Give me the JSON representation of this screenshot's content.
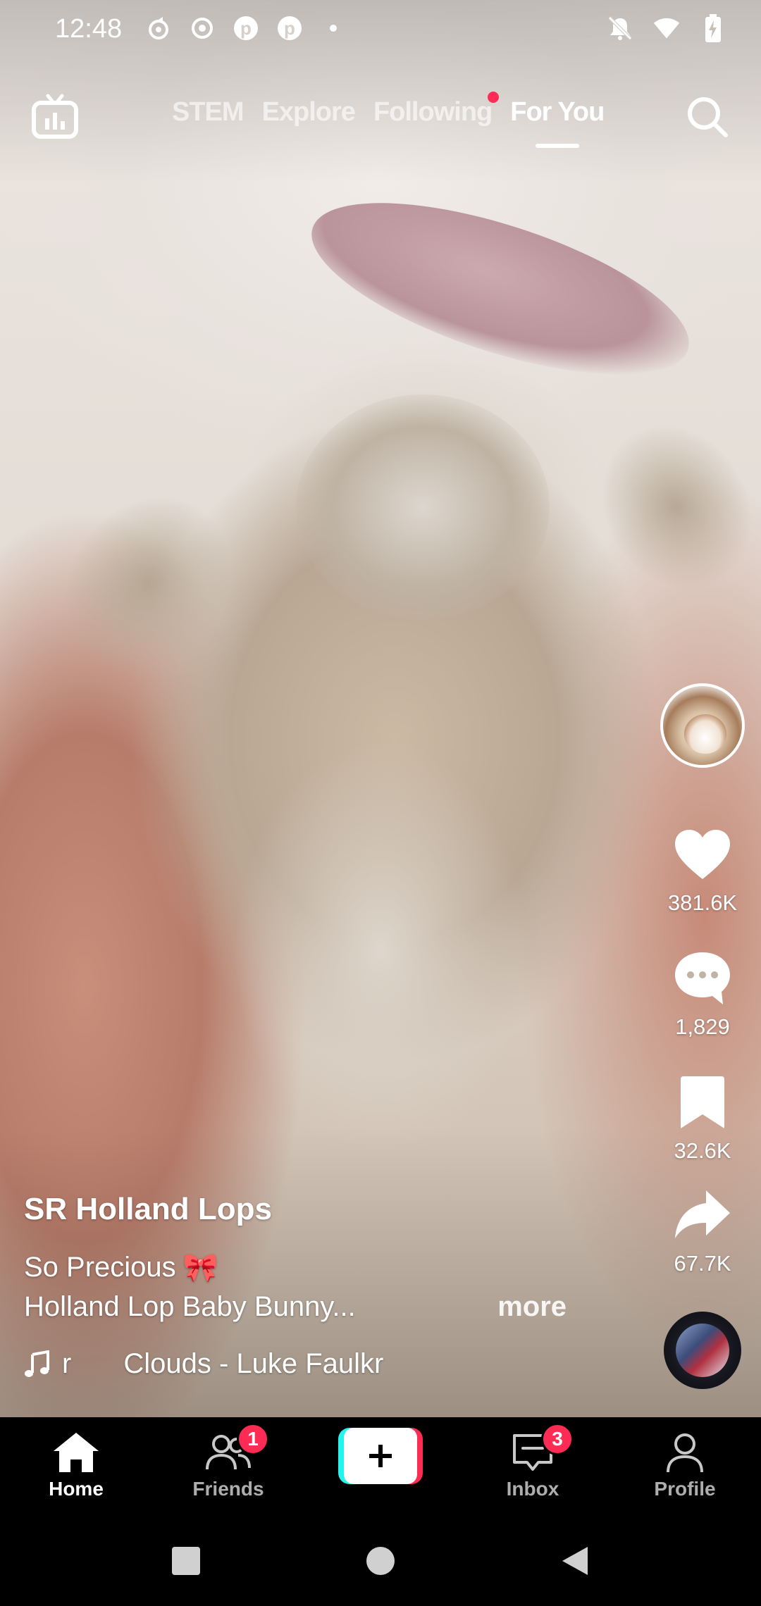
{
  "status_bar": {
    "time": "12:48",
    "left_icons": [
      "sync-icon",
      "record-icon",
      "pinterest-icon",
      "pinterest-icon",
      "dot-icon"
    ],
    "right_icons": [
      "mute-icon",
      "wifi-icon",
      "battery-charging-icon"
    ]
  },
  "top_nav": {
    "tabs": [
      {
        "label": "STEM",
        "active": false
      },
      {
        "label": "Explore",
        "active": false
      },
      {
        "label": "Following",
        "active": false,
        "dot": true
      },
      {
        "label": "For You",
        "active": true
      }
    ]
  },
  "rail": {
    "likes": "381.6K",
    "comments": "1,829",
    "saves": "32.6K",
    "shares": "67.7K"
  },
  "caption": {
    "username": "SR Holland Lops",
    "desc_line1": "So Precious",
    "desc_emoji": "🎀",
    "desc_line2": "Holland Lop Baby Bunny...",
    "more": "more",
    "sound_prefix": "r",
    "sound": "Clouds - Luke Faulkr"
  },
  "bottom_nav": {
    "items": [
      {
        "label": "Home",
        "active": true
      },
      {
        "label": "Friends",
        "badge": "1"
      },
      {
        "label": "Inbox",
        "badge": "3"
      },
      {
        "label": "Profile"
      }
    ]
  },
  "colors": {
    "accent_red": "#fe2c55",
    "accent_cyan": "#25f4ee",
    "nav_bg": "#000000"
  }
}
